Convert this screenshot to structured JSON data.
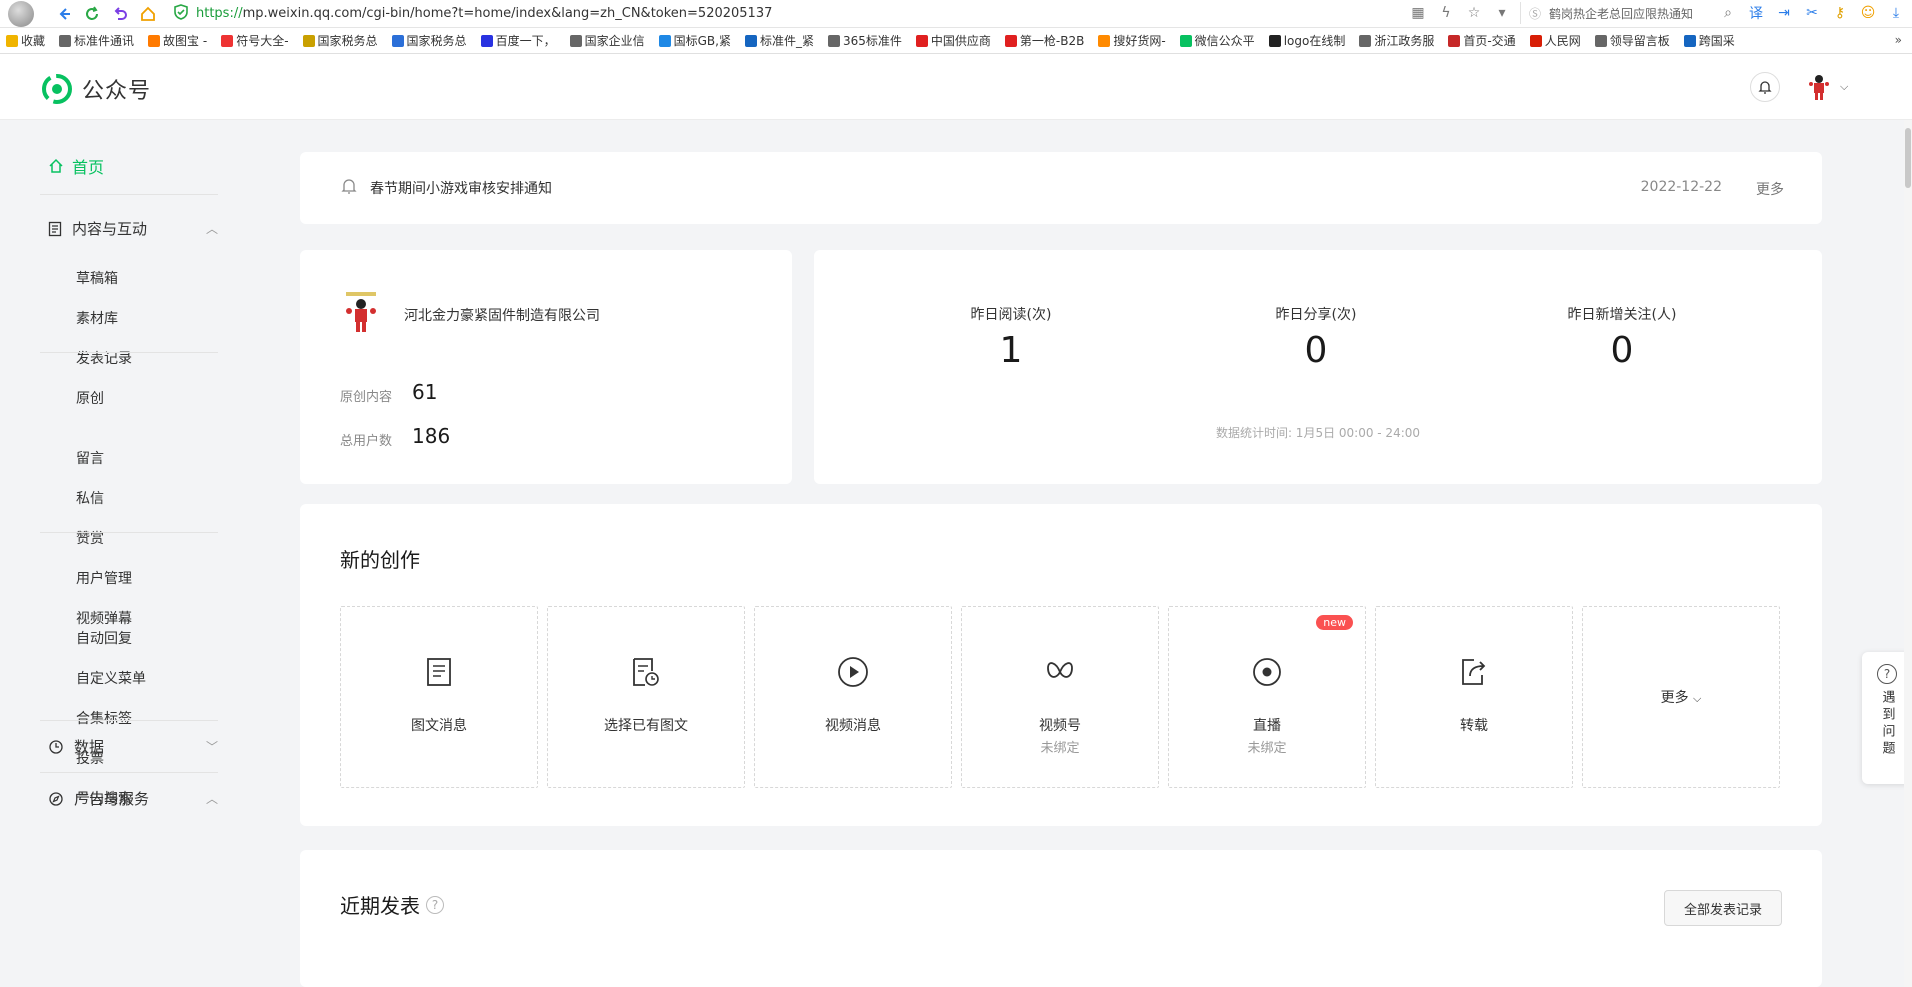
{
  "browser": {
    "url_scheme": "https://",
    "url_rest": "mp.weixin.qq.com/cgi-bin/home?t=home/index&lang=zh_CN&token=520205137",
    "search_placeholder": "鹤岗热企老总回应限热通知",
    "bookmarks": [
      {
        "label": "收藏",
        "color": "#f0b400"
      },
      {
        "label": "标准件通讯",
        "color": "#666666"
      },
      {
        "label": "故图宝 -",
        "color": "#ff7a00"
      },
      {
        "label": "符号大全-",
        "color": "#e33"
      },
      {
        "label": "国家税务总",
        "color": "#c9a000"
      },
      {
        "label": "国家税务总",
        "color": "#2b6fd8"
      },
      {
        "label": "百度一下，",
        "color": "#2932e1"
      },
      {
        "label": "国家企业信",
        "color": "#666666"
      },
      {
        "label": "国标GB,紧",
        "color": "#1e88e5"
      },
      {
        "label": "标准件_紧",
        "color": "#1565c0"
      },
      {
        "label": "365标准件",
        "color": "#666666"
      },
      {
        "label": "中国供应商",
        "color": "#e02020"
      },
      {
        "label": "第一枪-B2B",
        "color": "#e02020"
      },
      {
        "label": "搜好货网-",
        "color": "#ff8a00"
      },
      {
        "label": "微信公众平",
        "color": "#07c160"
      },
      {
        "label": "logo在线制",
        "color": "#222222"
      },
      {
        "label": "浙江政务服",
        "color": "#666666"
      },
      {
        "label": "首页-交通",
        "color": "#c62828"
      },
      {
        "label": "人民网",
        "color": "#d81e06"
      },
      {
        "label": "领导留言板",
        "color": "#666666"
      },
      {
        "label": "跨国采",
        "color": "#1565c0"
      }
    ],
    "bookmarks_more": "»"
  },
  "header": {
    "brand": "公众号"
  },
  "sidebar": {
    "home": "首页",
    "content_group": "内容与互动",
    "content_items": [
      "草稿箱",
      "素材库",
      "发表记录",
      "原创"
    ],
    "interact_items": [
      "留言",
      "私信",
      "赞赏",
      "用户管理",
      "视频弹幕"
    ],
    "feature_items": [
      "自动回复",
      "自定义菜单",
      "合集标签",
      "投票",
      "号内搜索"
    ],
    "data_group": "数据",
    "ads_group": "广告与服务"
  },
  "notice": {
    "title": "春节期间小游戏审核安排通知",
    "date": "2022-12-22",
    "more": "更多"
  },
  "account": {
    "name": "河北金力豪紧固件制造有限公司",
    "original_label": "原创内容",
    "original_value": "61",
    "users_label": "总用户数",
    "users_value": "186"
  },
  "yesterday": {
    "reads_label": "昨日阅读(次)",
    "reads_value": "1",
    "shares_label": "昨日分享(次)",
    "shares_value": "0",
    "follows_label": "昨日新增关注(人)",
    "follows_value": "0",
    "stat_time": "数据统计时间: 1月5日 00:00 - 24:00"
  },
  "create": {
    "title": "新的创作",
    "tiles": [
      {
        "label": "图文消息",
        "icon": "doc-icon"
      },
      {
        "label": "选择已有图文",
        "icon": "doc-clock-icon"
      },
      {
        "label": "视频消息",
        "icon": "play-icon"
      },
      {
        "label": "视频号",
        "sub": "未绑定",
        "icon": "channels-icon"
      },
      {
        "label": "直播",
        "sub": "未绑定",
        "icon": "live-icon",
        "badge": "new"
      },
      {
        "label": "转载",
        "icon": "share-out-icon"
      }
    ],
    "more": "更多"
  },
  "recent": {
    "title": "近期发表",
    "all_button": "全部发表记录"
  },
  "help": {
    "text": "遇到问题"
  },
  "colors": {
    "accent": "#07c160",
    "badge": "#fa5151"
  }
}
